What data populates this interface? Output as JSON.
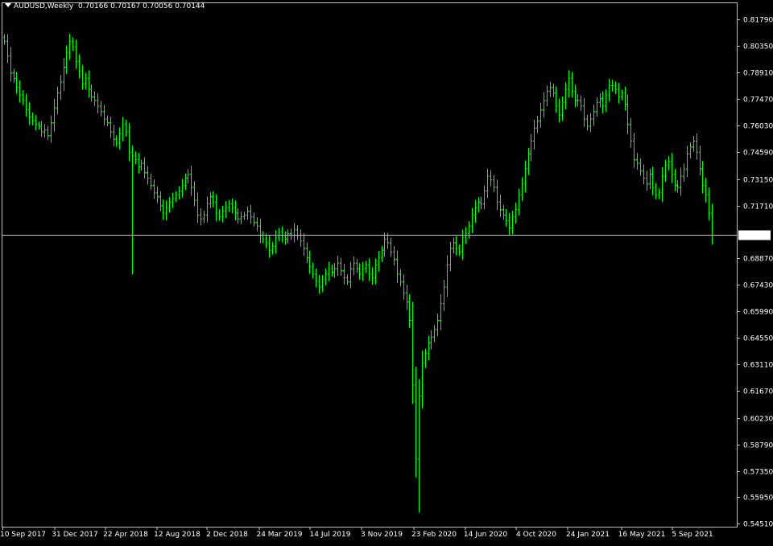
{
  "header": {
    "symbol": "AUDUSD,Weekly",
    "ohlc": "0.70166 0.70167 0.70056 0.70144"
  },
  "colors": {
    "background": "#000000",
    "candle": "#00ff00",
    "frame": "#c0c0c0",
    "price_line": "#c0c0c0",
    "text": "#ffffff"
  },
  "chart_data": {
    "type": "candlestick",
    "ylim": [
      0.5451,
      0.8248
    ],
    "y_ticks": [
      "0.81790",
      "0.80350",
      "0.78910",
      "0.77470",
      "0.76030",
      "0.74590",
      "0.73150",
      "0.71710",
      "0.70144",
      "0.68870",
      "0.67430",
      "0.65990",
      "0.64550",
      "0.63110",
      "0.61670",
      "0.60230",
      "0.58790",
      "0.57350",
      "0.55950",
      "0.54510"
    ],
    "y_tick_values": [
      0.8179,
      0.8035,
      0.7891,
      0.7747,
      0.7603,
      0.7459,
      0.7315,
      0.7171,
      0.70144,
      0.6887,
      0.6743,
      0.6599,
      0.6455,
      0.6311,
      0.6167,
      0.6023,
      0.5879,
      0.5735,
      0.5595,
      0.5451
    ],
    "x_ticks": [
      "10 Sep 2017",
      "31 Dec 2017",
      "22 Apr 2018",
      "12 Aug 2018",
      "2 Dec 2018",
      "24 Mar 2019",
      "14 Jul 2019",
      "3 Nov 2019",
      "23 Feb 2020",
      "14 Jun 2020",
      "4 Oct 2020",
      "24 Jan 2021",
      "16 May 2021",
      "5 Sep 2021"
    ],
    "current_price": "0.70144",
    "closes": [
      0.806,
      0.798,
      0.789,
      0.786,
      0.781,
      0.777,
      0.774,
      0.769,
      0.765,
      0.763,
      0.761,
      0.76,
      0.757,
      0.758,
      0.755,
      0.762,
      0.77,
      0.778,
      0.784,
      0.792,
      0.8,
      0.806,
      0.803,
      0.795,
      0.79,
      0.783,
      0.786,
      0.78,
      0.776,
      0.774,
      0.771,
      0.768,
      0.764,
      0.762,
      0.757,
      0.753,
      0.751,
      0.756,
      0.761,
      0.757,
      0.746,
      0.744,
      0.742,
      0.738,
      0.74,
      0.735,
      0.732,
      0.728,
      0.724,
      0.722,
      0.717,
      0.713,
      0.716,
      0.719,
      0.721,
      0.723,
      0.725,
      0.728,
      0.732,
      0.734,
      0.727,
      0.72,
      0.712,
      0.71,
      0.712,
      0.718,
      0.722,
      0.719,
      0.713,
      0.711,
      0.714,
      0.716,
      0.718,
      0.716,
      0.713,
      0.71,
      0.711,
      0.712,
      0.714,
      0.711,
      0.708,
      0.706,
      0.701,
      0.699,
      0.697,
      0.693,
      0.695,
      0.7,
      0.703,
      0.7,
      0.699,
      0.702,
      0.701,
      0.704,
      0.701,
      0.698,
      0.694,
      0.689,
      0.684,
      0.68,
      0.676,
      0.673,
      0.677,
      0.68,
      0.683,
      0.681,
      0.683,
      0.686,
      0.682,
      0.678,
      0.676,
      0.683,
      0.686,
      0.683,
      0.68,
      0.683,
      0.685,
      0.68,
      0.678,
      0.685,
      0.689,
      0.693,
      0.699,
      0.697,
      0.692,
      0.688,
      0.68,
      0.676,
      0.67,
      0.665,
      0.655,
      0.62,
      0.58,
      0.614,
      0.632,
      0.637,
      0.643,
      0.646,
      0.65,
      0.655,
      0.664,
      0.673,
      0.685,
      0.694,
      0.697,
      0.694,
      0.692,
      0.7,
      0.702,
      0.706,
      0.712,
      0.716,
      0.719,
      0.718,
      0.725,
      0.733,
      0.731,
      0.727,
      0.719,
      0.715,
      0.712,
      0.709,
      0.705,
      0.711,
      0.715,
      0.723,
      0.729,
      0.737,
      0.745,
      0.752,
      0.759,
      0.763,
      0.769,
      0.774,
      0.779,
      0.781,
      0.778,
      0.771,
      0.766,
      0.773,
      0.78,
      0.786,
      0.779,
      0.774,
      0.774,
      0.771,
      0.764,
      0.76,
      0.764,
      0.768,
      0.773,
      0.775,
      0.771,
      0.777,
      0.782,
      0.782,
      0.78,
      0.776,
      0.778,
      0.772,
      0.761,
      0.752,
      0.742,
      0.74,
      0.736,
      0.732,
      0.729,
      0.734,
      0.727,
      0.723,
      0.724,
      0.733,
      0.739,
      0.741,
      0.734,
      0.728,
      0.727,
      0.733,
      0.737,
      0.745,
      0.749,
      0.752,
      0.746,
      0.737,
      0.728,
      0.723,
      0.713,
      0.701
    ]
  }
}
